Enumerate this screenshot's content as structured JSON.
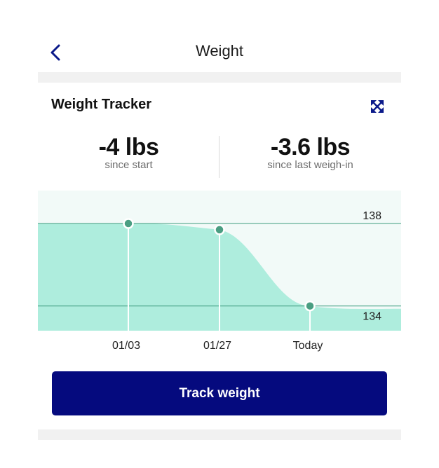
{
  "header": {
    "title": "Weight",
    "back_icon": "chevron-left-icon"
  },
  "tracker": {
    "title": "Weight Tracker",
    "expand_icon": "expand-arrows-icon",
    "stats": [
      {
        "value": "-4 lbs",
        "label": "since start"
      },
      {
        "value": "-3.6 lbs",
        "label": "since last weigh-in"
      }
    ]
  },
  "chart_data": {
    "type": "area",
    "categories": [
      "01/03",
      "01/27",
      "Today"
    ],
    "values": [
      138,
      137.7,
      134
    ],
    "reference_lines": [
      138,
      134
    ],
    "reference_labels": [
      "138",
      "134"
    ],
    "ylim": [
      132.8,
      139.6
    ],
    "title": "",
    "xlabel": "",
    "ylabel": "",
    "grid": false,
    "colors": {
      "background": "#f2faf8",
      "fill": "#aeeddd",
      "line": "#3d9c7e",
      "point": "#4a9e82"
    }
  },
  "actions": {
    "track_label": "Track weight"
  },
  "colors": {
    "primary": "#050a7e",
    "icon": "#0b1a8a",
    "divider": "#f1f1f1"
  }
}
